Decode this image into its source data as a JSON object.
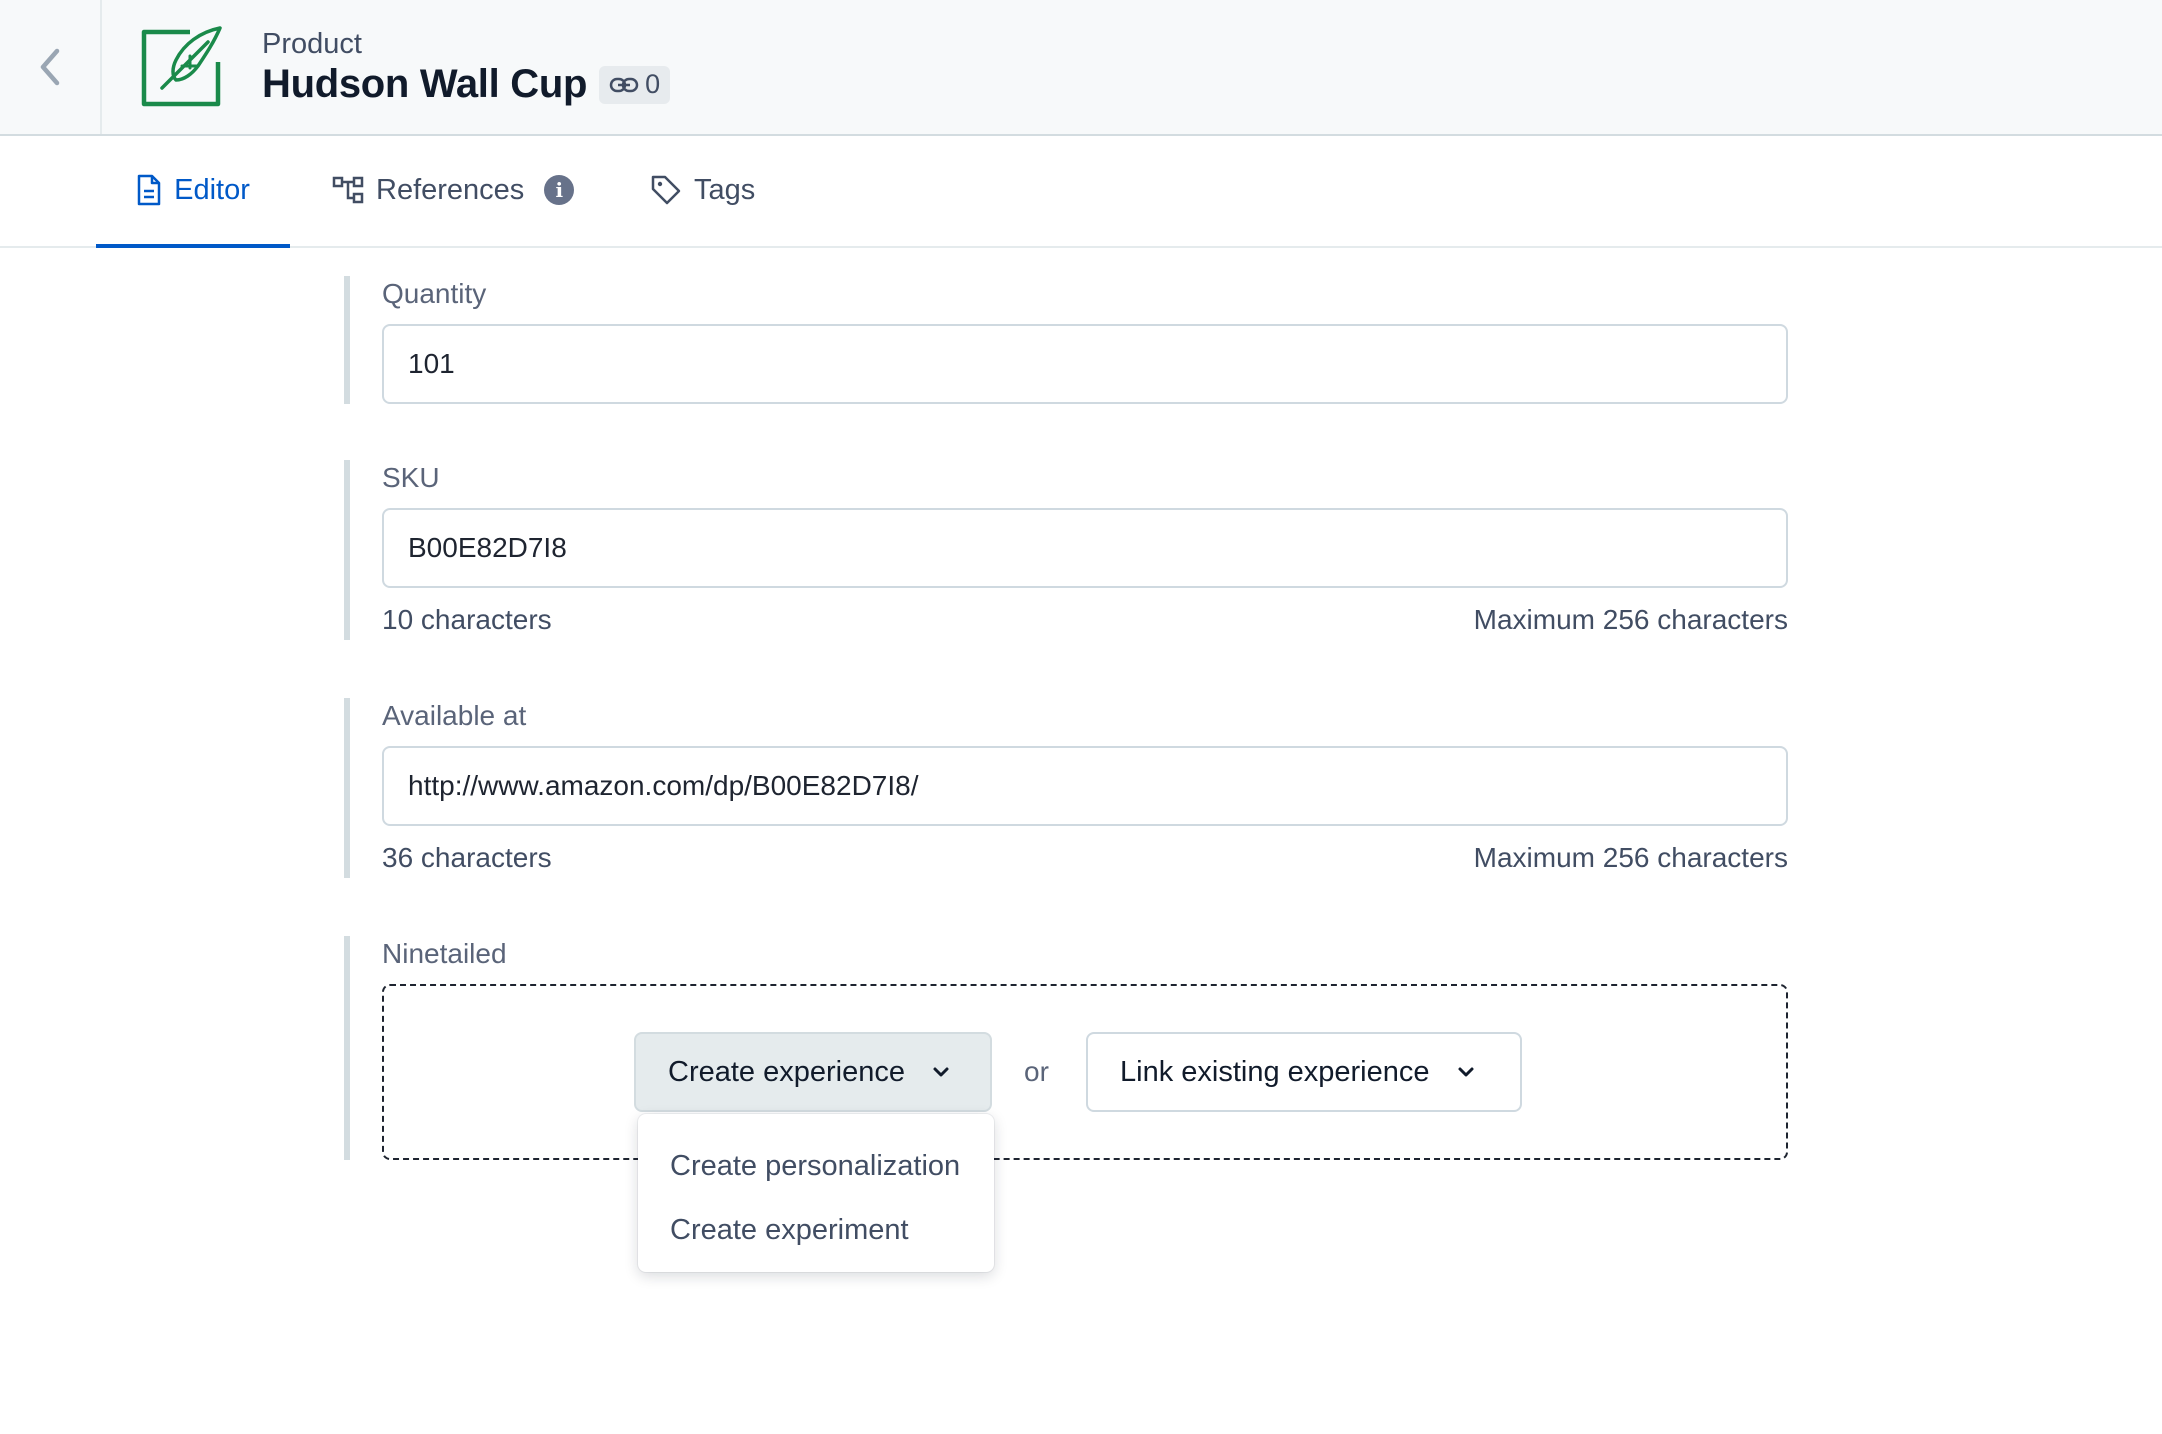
{
  "header": {
    "content_type": "Product",
    "title": "Hudson Wall Cup",
    "link_count": "0"
  },
  "tabs": [
    {
      "label": "Editor",
      "icon": "document-icon",
      "active": true
    },
    {
      "label": "References",
      "icon": "references-icon",
      "active": false
    },
    {
      "label": "Tags",
      "icon": "tag-icon",
      "active": false
    }
  ],
  "fields": {
    "quantity": {
      "label": "Quantity",
      "value": "101"
    },
    "sku": {
      "label": "SKU",
      "value": "B00E82D7I8",
      "count": "10 characters",
      "max": "Maximum 256 characters"
    },
    "available_at": {
      "label": "Available at",
      "value": "http://www.amazon.com/dp/B00E82D7I8/",
      "count": "36 characters",
      "max": "Maximum 256 characters"
    },
    "ninetailed": {
      "label": "Ninetailed",
      "create_button": "Create experience",
      "or_text": "or",
      "link_button": "Link existing experience",
      "menu": [
        "Create personalization",
        "Create experiment"
      ]
    }
  },
  "colors": {
    "accent": "#0059c8",
    "icon_green": "#1a8a4a",
    "header_bg": "#f7f9fa"
  }
}
